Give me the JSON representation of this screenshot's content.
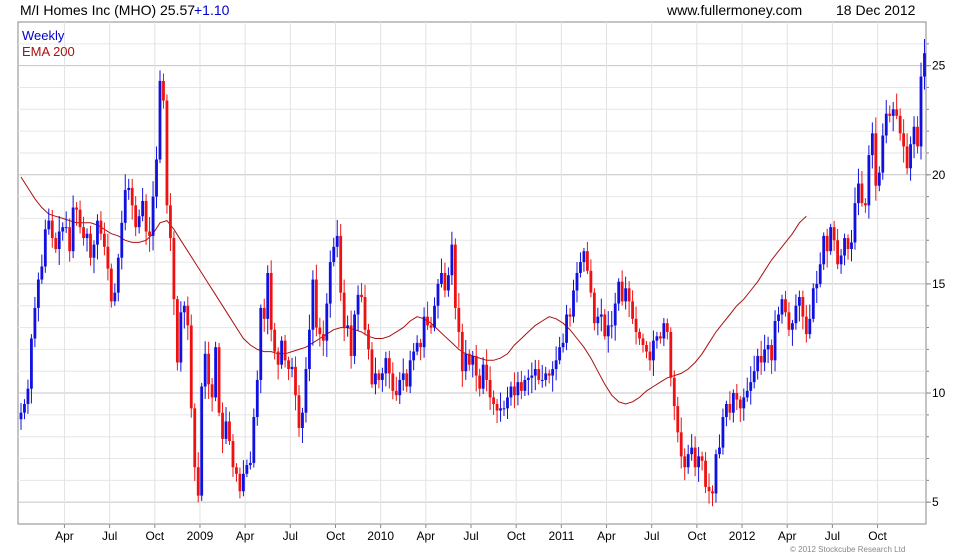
{
  "header": {
    "title": "M/I Homes Inc (MHO) 25.57",
    "change": "+1.10",
    "site": "www.fullermoney.com",
    "date": "18 Dec 2012"
  },
  "footer": {
    "copyright": "© 2012 Stockcube Research Ltd"
  },
  "colors": {
    "up": "#1010e0",
    "down": "#ee1111",
    "ema": "#aa1111",
    "grid": "#d0d0d0",
    "axis": "#888888"
  },
  "chart_data": {
    "type": "candlestick",
    "title": "M/I Homes Inc (MHO) 25.57 +1.10",
    "period": "Weekly",
    "overlay": "EMA 200",
    "legend": [
      "Weekly",
      "EMA 200"
    ],
    "legend_position": "top-left",
    "grid": true,
    "ylim": [
      4,
      27
    ],
    "y_ticks": [
      5,
      10,
      15,
      20,
      25
    ],
    "x_ticks": [
      "Apr",
      "Jul",
      "Oct",
      "2009",
      "Apr",
      "Jul",
      "Oct",
      "2010",
      "Apr",
      "Jul",
      "Oct",
      "2011",
      "Apr",
      "Jul",
      "Oct",
      "2012",
      "Apr",
      "Jul",
      "Oct"
    ],
    "x_tick_positions": [
      12.5,
      25.5,
      38.5,
      51.5,
      64.5,
      77.5,
      90.5,
      103.5,
      116.5,
      129.5,
      142.5,
      155.5,
      168.5,
      181.5,
      194.5,
      207.5,
      220.5,
      233.5,
      246.5
    ],
    "x_range": [
      0,
      259
    ],
    "closes": [
      9.1,
      9.5,
      10.2,
      12.5,
      13.9,
      15.2,
      15.8,
      17.5,
      17.9,
      17.1,
      16.6,
      17.4,
      17.6,
      17.6,
      16.5,
      18.5,
      18.4,
      17.6,
      17.1,
      17.3,
      16.2,
      16.8,
      17.9,
      17.3,
      16.7,
      15.7,
      14.2,
      14.6,
      16.2,
      17.8,
      19.3,
      19.4,
      18.6,
      17.6,
      18.1,
      18.8,
      17.4,
      17.2,
      19.0,
      20.7,
      24.3,
      23.4,
      18.6,
      17.1,
      14.3,
      11.4,
      13.7,
      14.0,
      13.1,
      9.3,
      6.6,
      5.3,
      10.3,
      11.8,
      10.4,
      9.8,
      12.1,
      9.1,
      7.9,
      8.7,
      7.8,
      6.6,
      6.3,
      5.5,
      6.3,
      6.7,
      6.8,
      8.9,
      10.6,
      13.9,
      13.4,
      15.5,
      12.9,
      11.9,
      11.3,
      12.4,
      11.5,
      11.1,
      11.2,
      9.9,
      8.4,
      9.1,
      11.1,
      12.9,
      15.2,
      13.0,
      12.7,
      12.4,
      14.1,
      16.0,
      16.7,
      17.2,
      14.6,
      13.0,
      13.1,
      11.7,
      13.6,
      14.5,
      14.4,
      12.9,
      12.0,
      10.4,
      10.9,
      10.6,
      10.9,
      11.6,
      10.9,
      10.1,
      9.9,
      10.6,
      10.9,
      10.3,
      11.5,
      11.9,
      12.3,
      12.1,
      13.5,
      13.1,
      13.0,
      14.0,
      15.0,
      15.5,
      14.7,
      15.4,
      16.8,
      13.9,
      12.8,
      11.0,
      11.8,
      11.3,
      11.7,
      10.8,
      10.2,
      11.3,
      10.6,
      9.8,
      9.5,
      9.2,
      9.3,
      9.3,
      9.8,
      10.3,
      9.9,
      10.5,
      10.1,
      10.6,
      10.7,
      10.8,
      11.1,
      10.6,
      10.6,
      10.9,
      10.8,
      11.1,
      11.5,
      12.1,
      12.3,
      13.6,
      13.5,
      14.7,
      15.5,
      16.0,
      16.5,
      15.6,
      14.6,
      13.2,
      13.5,
      13.6,
      12.6,
      13.1,
      13.1,
      14.1,
      15.1,
      14.2,
      14.8,
      14.2,
      13.4,
      12.8,
      12.5,
      12.2,
      11.9,
      11.5,
      12.4,
      12.6,
      12.5,
      13.2,
      12.8,
      10.7,
      9.4,
      8.2,
      7.1,
      6.6,
      7.2,
      7.5,
      6.6,
      7.1,
      6.9,
      5.7,
      5.5,
      5.4,
      7.2,
      7.5,
      8.9,
      9.5,
      9.1,
      10.0,
      9.7,
      9.3,
      9.8,
      10.1,
      10.5,
      11.0,
      11.7,
      11.4,
      12.0,
      12.2,
      11.5,
      13.3,
      13.6,
      14.3,
      13.7,
      12.9,
      13.2,
      14.0,
      14.4,
      13.5,
      12.7,
      13.4,
      14.8,
      15.0,
      15.9,
      17.2,
      16.5,
      17.6,
      17.0,
      15.9,
      16.3,
      17.1,
      16.6,
      16.9,
      18.7,
      19.6,
      18.7,
      18.6,
      20.9,
      21.9,
      19.5,
      20.1,
      21.8,
      22.8,
      22.7,
      23.0,
      22.7,
      21.9,
      21.3,
      20.3,
      21.4,
      22.2,
      21.3,
      24.5,
      25.57
    ],
    "ema_200": [
      19.9,
      19.4,
      18.9,
      18.5,
      18.2,
      18.1,
      18.0,
      17.9,
      17.8,
      17.8,
      17.8,
      17.7,
      17.5,
      17.3,
      17.2,
      17.0,
      16.9,
      16.9,
      17.0,
      17.3,
      17.8,
      17.9,
      17.5,
      17.0,
      16.5,
      16.0,
      15.5,
      15.0,
      14.5,
      14.0,
      13.5,
      13.0,
      12.5,
      12.2,
      12.0,
      11.9,
      11.9,
      11.8,
      11.8,
      11.9,
      12.0,
      12.1,
      12.3,
      12.5,
      12.7,
      12.9,
      13.0,
      13.0,
      12.9,
      12.8,
      12.6,
      12.5,
      12.5,
      12.6,
      12.8,
      13.0,
      13.3,
      13.5,
      13.4,
      13.2,
      12.9,
      12.6,
      12.3,
      12.0,
      11.8,
      11.7,
      11.6,
      11.5,
      11.5,
      11.6,
      11.8,
      12.2,
      12.5,
      12.8,
      13.1,
      13.3,
      13.5,
      13.4,
      13.2,
      12.9,
      12.5,
      12.1,
      11.6,
      11.0,
      10.4,
      9.9,
      9.6,
      9.5,
      9.6,
      9.8,
      10.1,
      10.3,
      10.5,
      10.7,
      10.8,
      10.9,
      11.1,
      11.4,
      11.8,
      12.3,
      12.8,
      13.2,
      13.6,
      14.0,
      14.3,
      14.7,
      15.1,
      15.6,
      16.1,
      16.5,
      16.9,
      17.3,
      17.8,
      18.1
    ],
    "ema_x": [
      0,
      2,
      4,
      6,
      8,
      10,
      12,
      14,
      16,
      18,
      20,
      22,
      24,
      26,
      28,
      30,
      32,
      34,
      36,
      38,
      40,
      42,
      44,
      46,
      48,
      50,
      52,
      54,
      56,
      58,
      60,
      62,
      64,
      66,
      68,
      70,
      72,
      74,
      76,
      78,
      80,
      82,
      84,
      86,
      88,
      90,
      92,
      94,
      96,
      98,
      100,
      102,
      104,
      106,
      108,
      110,
      112,
      114,
      116,
      118,
      120,
      122,
      124,
      126,
      128,
      130,
      132,
      134,
      136,
      138,
      140,
      142,
      144,
      146,
      148,
      150,
      152,
      154,
      156,
      158,
      160,
      162,
      164,
      166,
      168,
      170,
      172,
      174,
      176,
      178,
      180,
      182,
      184,
      186,
      188,
      190,
      192,
      194,
      196,
      198,
      200,
      202,
      204,
      206,
      208,
      210,
      212,
      214,
      216,
      218,
      220,
      222,
      224,
      226,
      228,
      230
    ]
  }
}
